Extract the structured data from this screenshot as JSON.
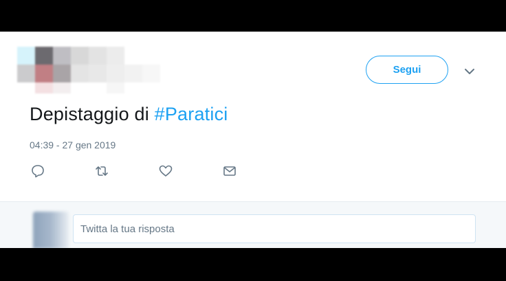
{
  "tweet": {
    "follow_label": "Segui",
    "text_plain": "Depistaggio di ",
    "hashtag": "#Paratici",
    "timestamp": "04:39 - 27 gen 2019"
  },
  "actions": {
    "reply_icon": "reply-icon",
    "retweet_icon": "retweet-icon",
    "like_icon": "heart-icon",
    "dm_icon": "envelope-icon"
  },
  "reply": {
    "placeholder": "Twitta la tua risposta"
  },
  "colors": {
    "accent": "#1da1f2",
    "text": "#14171a",
    "muted": "#657786"
  }
}
